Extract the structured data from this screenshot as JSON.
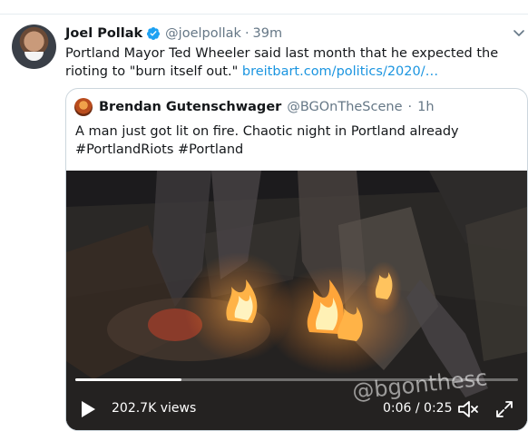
{
  "tweet": {
    "author_name": "Joel Pollak",
    "handle": "@joelpollak",
    "separator": "·",
    "time": "39m",
    "text_prefix": "Portland Mayor Ted Wheeler said last month that he expected the rioting to \"burn itself out.\" ",
    "link_text": "breitbart.com/politics/2020/…"
  },
  "quoted": {
    "author_name": "Brendan Gutenschwager",
    "handle": "@BGOnTheScene",
    "separator": "·",
    "time": "1h",
    "text_line1": "A man just got lit on fire. Chaotic night in Portland already",
    "text_line2": "#PortlandRiots #Portland"
  },
  "video": {
    "watermark": "@bgonthesc",
    "views": "202.7K views",
    "timecode": "0:06 / 0:25",
    "progress": 0.24
  },
  "colors": {
    "link": "#1b95e0",
    "verified": "#1da1f2",
    "secondary_text": "#657786",
    "border": "#ccd6dd"
  },
  "icons": [
    "verified-badge-icon",
    "chevron-down-icon",
    "play-icon",
    "volume-icon",
    "fullscreen-icon"
  ]
}
